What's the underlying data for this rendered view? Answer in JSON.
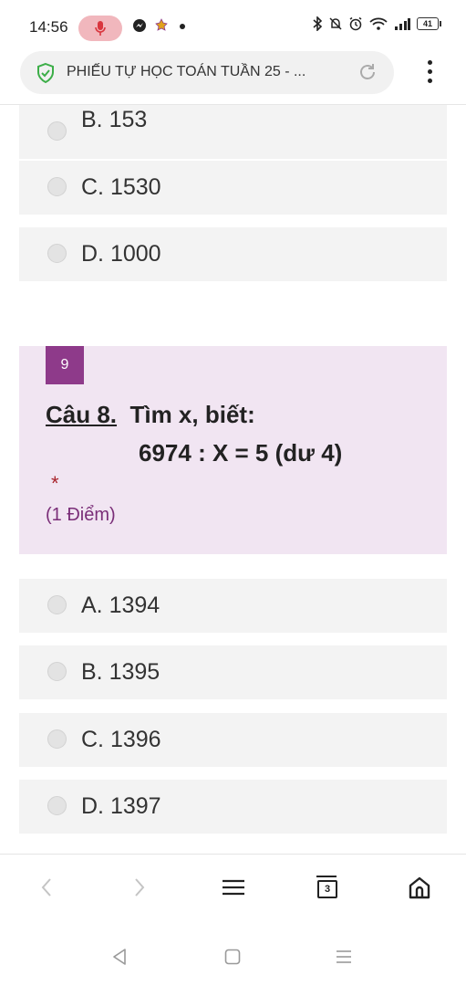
{
  "status_bar": {
    "time": "14:56",
    "battery": "41"
  },
  "browser": {
    "url_title": "PHIẾU TỰ HỌC TOÁN TUẦN 25 - ...",
    "tab_count": "3"
  },
  "previous_question": {
    "options": [
      {
        "label": "B. 153"
      },
      {
        "label": "C. 1530"
      },
      {
        "label": "D. 1000"
      }
    ]
  },
  "question": {
    "number_badge": "9",
    "label_prefix": "Câu 8.",
    "prompt": "Tìm x, biết:",
    "expression": "6974 : X = 5 (dư 4)",
    "required_mark": "*",
    "points": "(1 Điểm)",
    "options": [
      {
        "label": "A. 1394"
      },
      {
        "label": "B. 1395"
      },
      {
        "label": "C. 1396"
      },
      {
        "label": "D. 1397"
      }
    ]
  },
  "colors": {
    "question_bg": "#f1e5f2",
    "badge": "#8e3a8a",
    "required": "#a8232b",
    "option_bg": "#f3f3f3"
  }
}
